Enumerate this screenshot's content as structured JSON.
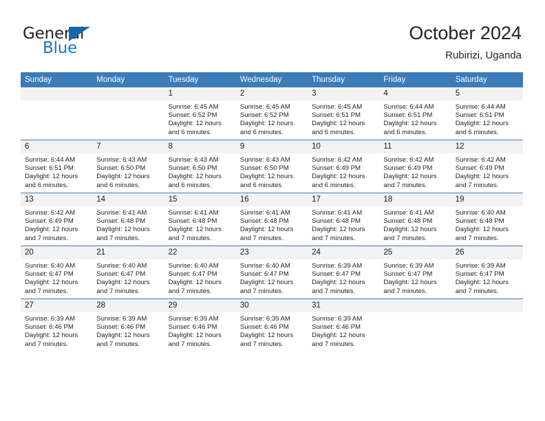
{
  "brand": {
    "name_top": "General",
    "name_bottom": "Blue",
    "triangle_color": "#1667b0",
    "text_color_top": "#231f20",
    "text_color_bottom": "#1279c4"
  },
  "header": {
    "title": "October 2024",
    "subtitle": "Rubirizi, Uganda"
  },
  "theme": {
    "header_blue": "#3b7cb8",
    "daynum_band": "#f2f2f2",
    "grid_line": "#3b7cb8",
    "text": "#232323"
  },
  "weekdays": [
    "Sunday",
    "Monday",
    "Tuesday",
    "Wednesday",
    "Thursday",
    "Friday",
    "Saturday"
  ],
  "weeks": [
    [
      {
        "day": "",
        "empty": true,
        "sunrise": "",
        "sunset": "",
        "daylight_line1": "",
        "daylight_line2": ""
      },
      {
        "day": "",
        "empty": true,
        "sunrise": "",
        "sunset": "",
        "daylight_line1": "",
        "daylight_line2": ""
      },
      {
        "day": "1",
        "sunrise": "Sunrise: 6:45 AM",
        "sunset": "Sunset: 6:52 PM",
        "daylight_line1": "Daylight: 12 hours",
        "daylight_line2": "and 6 minutes."
      },
      {
        "day": "2",
        "sunrise": "Sunrise: 6:45 AM",
        "sunset": "Sunset: 6:52 PM",
        "daylight_line1": "Daylight: 12 hours",
        "daylight_line2": "and 6 minutes."
      },
      {
        "day": "3",
        "sunrise": "Sunrise: 6:45 AM",
        "sunset": "Sunset: 6:51 PM",
        "daylight_line1": "Daylight: 12 hours",
        "daylight_line2": "and 6 minutes."
      },
      {
        "day": "4",
        "sunrise": "Sunrise: 6:44 AM",
        "sunset": "Sunset: 6:51 PM",
        "daylight_line1": "Daylight: 12 hours",
        "daylight_line2": "and 6 minutes."
      },
      {
        "day": "5",
        "sunrise": "Sunrise: 6:44 AM",
        "sunset": "Sunset: 6:51 PM",
        "daylight_line1": "Daylight: 12 hours",
        "daylight_line2": "and 6 minutes."
      }
    ],
    [
      {
        "day": "6",
        "sunrise": "Sunrise: 6:44 AM",
        "sunset": "Sunset: 6:51 PM",
        "daylight_line1": "Daylight: 12 hours",
        "daylight_line2": "and 6 minutes."
      },
      {
        "day": "7",
        "sunrise": "Sunrise: 6:43 AM",
        "sunset": "Sunset: 6:50 PM",
        "daylight_line1": "Daylight: 12 hours",
        "daylight_line2": "and 6 minutes."
      },
      {
        "day": "8",
        "sunrise": "Sunrise: 6:43 AM",
        "sunset": "Sunset: 6:50 PM",
        "daylight_line1": "Daylight: 12 hours",
        "daylight_line2": "and 6 minutes."
      },
      {
        "day": "9",
        "sunrise": "Sunrise: 6:43 AM",
        "sunset": "Sunset: 6:50 PM",
        "daylight_line1": "Daylight: 12 hours",
        "daylight_line2": "and 6 minutes."
      },
      {
        "day": "10",
        "sunrise": "Sunrise: 6:42 AM",
        "sunset": "Sunset: 6:49 PM",
        "daylight_line1": "Daylight: 12 hours",
        "daylight_line2": "and 6 minutes."
      },
      {
        "day": "11",
        "sunrise": "Sunrise: 6:42 AM",
        "sunset": "Sunset: 6:49 PM",
        "daylight_line1": "Daylight: 12 hours",
        "daylight_line2": "and 7 minutes."
      },
      {
        "day": "12",
        "sunrise": "Sunrise: 6:42 AM",
        "sunset": "Sunset: 6:49 PM",
        "daylight_line1": "Daylight: 12 hours",
        "daylight_line2": "and 7 minutes."
      }
    ],
    [
      {
        "day": "13",
        "sunrise": "Sunrise: 6:42 AM",
        "sunset": "Sunset: 6:49 PM",
        "daylight_line1": "Daylight: 12 hours",
        "daylight_line2": "and 7 minutes."
      },
      {
        "day": "14",
        "sunrise": "Sunrise: 6:41 AM",
        "sunset": "Sunset: 6:48 PM",
        "daylight_line1": "Daylight: 12 hours",
        "daylight_line2": "and 7 minutes."
      },
      {
        "day": "15",
        "sunrise": "Sunrise: 6:41 AM",
        "sunset": "Sunset: 6:48 PM",
        "daylight_line1": "Daylight: 12 hours",
        "daylight_line2": "and 7 minutes."
      },
      {
        "day": "16",
        "sunrise": "Sunrise: 6:41 AM",
        "sunset": "Sunset: 6:48 PM",
        "daylight_line1": "Daylight: 12 hours",
        "daylight_line2": "and 7 minutes."
      },
      {
        "day": "17",
        "sunrise": "Sunrise: 6:41 AM",
        "sunset": "Sunset: 6:48 PM",
        "daylight_line1": "Daylight: 12 hours",
        "daylight_line2": "and 7 minutes."
      },
      {
        "day": "18",
        "sunrise": "Sunrise: 6:41 AM",
        "sunset": "Sunset: 6:48 PM",
        "daylight_line1": "Daylight: 12 hours",
        "daylight_line2": "and 7 minutes."
      },
      {
        "day": "19",
        "sunrise": "Sunrise: 6:40 AM",
        "sunset": "Sunset: 6:48 PM",
        "daylight_line1": "Daylight: 12 hours",
        "daylight_line2": "and 7 minutes."
      }
    ],
    [
      {
        "day": "20",
        "sunrise": "Sunrise: 6:40 AM",
        "sunset": "Sunset: 6:47 PM",
        "daylight_line1": "Daylight: 12 hours",
        "daylight_line2": "and 7 minutes."
      },
      {
        "day": "21",
        "sunrise": "Sunrise: 6:40 AM",
        "sunset": "Sunset: 6:47 PM",
        "daylight_line1": "Daylight: 12 hours",
        "daylight_line2": "and 7 minutes."
      },
      {
        "day": "22",
        "sunrise": "Sunrise: 6:40 AM",
        "sunset": "Sunset: 6:47 PM",
        "daylight_line1": "Daylight: 12 hours",
        "daylight_line2": "and 7 minutes."
      },
      {
        "day": "23",
        "sunrise": "Sunrise: 6:40 AM",
        "sunset": "Sunset: 6:47 PM",
        "daylight_line1": "Daylight: 12 hours",
        "daylight_line2": "and 7 minutes."
      },
      {
        "day": "24",
        "sunrise": "Sunrise: 6:39 AM",
        "sunset": "Sunset: 6:47 PM",
        "daylight_line1": "Daylight: 12 hours",
        "daylight_line2": "and 7 minutes."
      },
      {
        "day": "25",
        "sunrise": "Sunrise: 6:39 AM",
        "sunset": "Sunset: 6:47 PM",
        "daylight_line1": "Daylight: 12 hours",
        "daylight_line2": "and 7 minutes."
      },
      {
        "day": "26",
        "sunrise": "Sunrise: 6:39 AM",
        "sunset": "Sunset: 6:47 PM",
        "daylight_line1": "Daylight: 12 hours",
        "daylight_line2": "and 7 minutes."
      }
    ],
    [
      {
        "day": "27",
        "sunrise": "Sunrise: 6:39 AM",
        "sunset": "Sunset: 6:46 PM",
        "daylight_line1": "Daylight: 12 hours",
        "daylight_line2": "and 7 minutes."
      },
      {
        "day": "28",
        "sunrise": "Sunrise: 6:39 AM",
        "sunset": "Sunset: 6:46 PM",
        "daylight_line1": "Daylight: 12 hours",
        "daylight_line2": "and 7 minutes."
      },
      {
        "day": "29",
        "sunrise": "Sunrise: 6:39 AM",
        "sunset": "Sunset: 6:46 PM",
        "daylight_line1": "Daylight: 12 hours",
        "daylight_line2": "and 7 minutes."
      },
      {
        "day": "30",
        "sunrise": "Sunrise: 6:39 AM",
        "sunset": "Sunset: 6:46 PM",
        "daylight_line1": "Daylight: 12 hours",
        "daylight_line2": "and 7 minutes."
      },
      {
        "day": "31",
        "sunrise": "Sunrise: 6:39 AM",
        "sunset": "Sunset: 6:46 PM",
        "daylight_line1": "Daylight: 12 hours",
        "daylight_line2": "and 7 minutes."
      },
      {
        "day": "",
        "empty": true,
        "sunrise": "",
        "sunset": "",
        "daylight_line1": "",
        "daylight_line2": ""
      },
      {
        "day": "",
        "empty": true,
        "sunrise": "",
        "sunset": "",
        "daylight_line1": "",
        "daylight_line2": ""
      }
    ]
  ]
}
